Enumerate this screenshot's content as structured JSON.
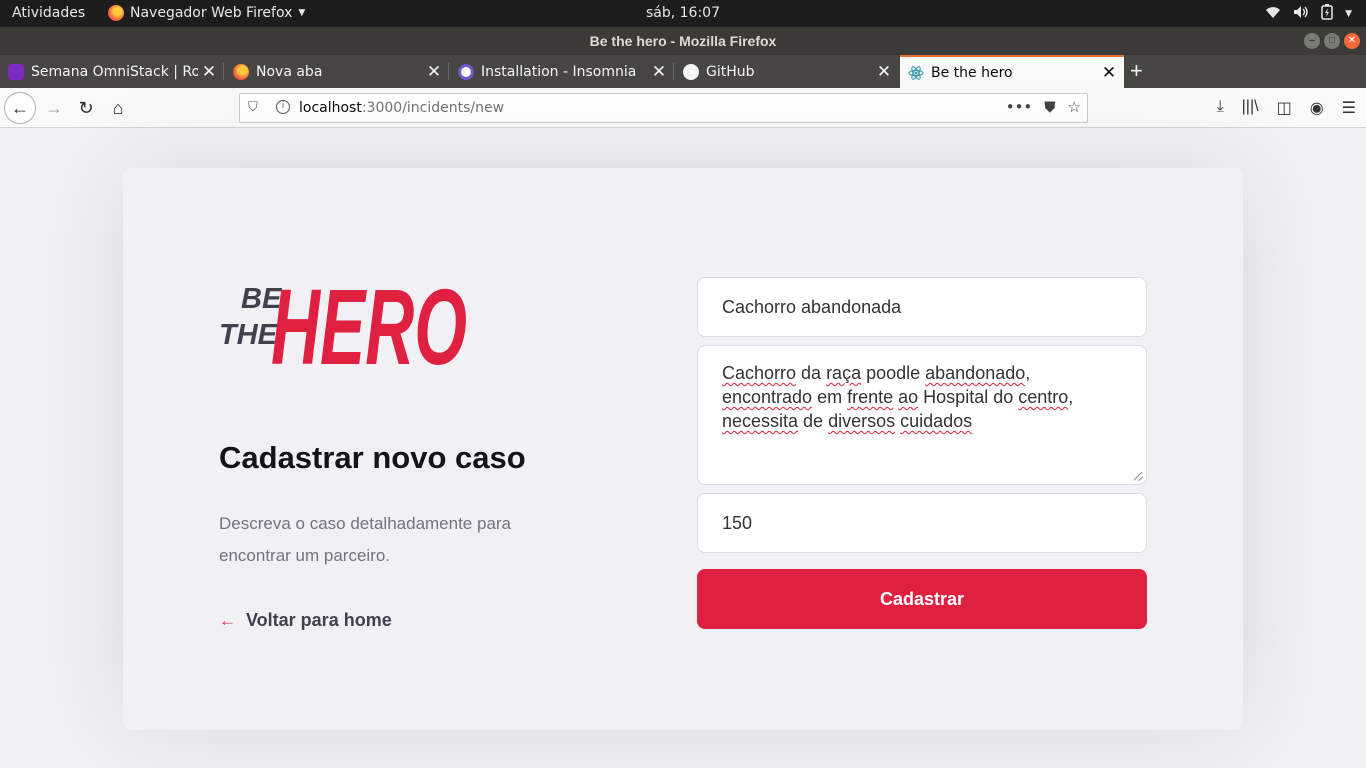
{
  "system_bar": {
    "activities": "Atividades",
    "app_menu": "Navegador Web Firefox",
    "clock": "sáb, 16:07"
  },
  "window": {
    "title": "Be the hero - Mozilla Firefox"
  },
  "tabs": [
    {
      "label": "Semana OmniStack | Roc",
      "icon": "rocketseat-icon",
      "color": "#7b2cbf"
    },
    {
      "label": "Nova aba",
      "icon": "firefox-icon",
      "color": "#ff7139"
    },
    {
      "label": "Installation - Insomnia",
      "icon": "insomnia-icon",
      "color": "#6a5acd"
    },
    {
      "label": "GitHub",
      "icon": "github-icon",
      "color": "#f4f4f4"
    },
    {
      "label": "Be the hero",
      "icon": "react-icon",
      "color": "#61dafb",
      "active": true
    }
  ],
  "address_bar": {
    "host": "localhost",
    "path": ":3000/incidents/new"
  },
  "page": {
    "logo": {
      "line1": "BE",
      "line2": "THE",
      "line3": "HERO"
    },
    "title": "Cadastrar novo caso",
    "description": "Descreva o caso detalhadamente para encontrar um parceiro.",
    "back_link": "Voltar para home",
    "form": {
      "title_value": "Cachorro abandonada",
      "description_value": "Cachorro da raça poodle abandonado, encontrado em frente ao Hospital do centro, necessita de diversos cuidados",
      "value_value": "150",
      "submit_label": "Cadastrar"
    },
    "colors": {
      "accent": "#e02041",
      "background": "#f0f0f5",
      "logo_dark": "#41414d"
    }
  }
}
